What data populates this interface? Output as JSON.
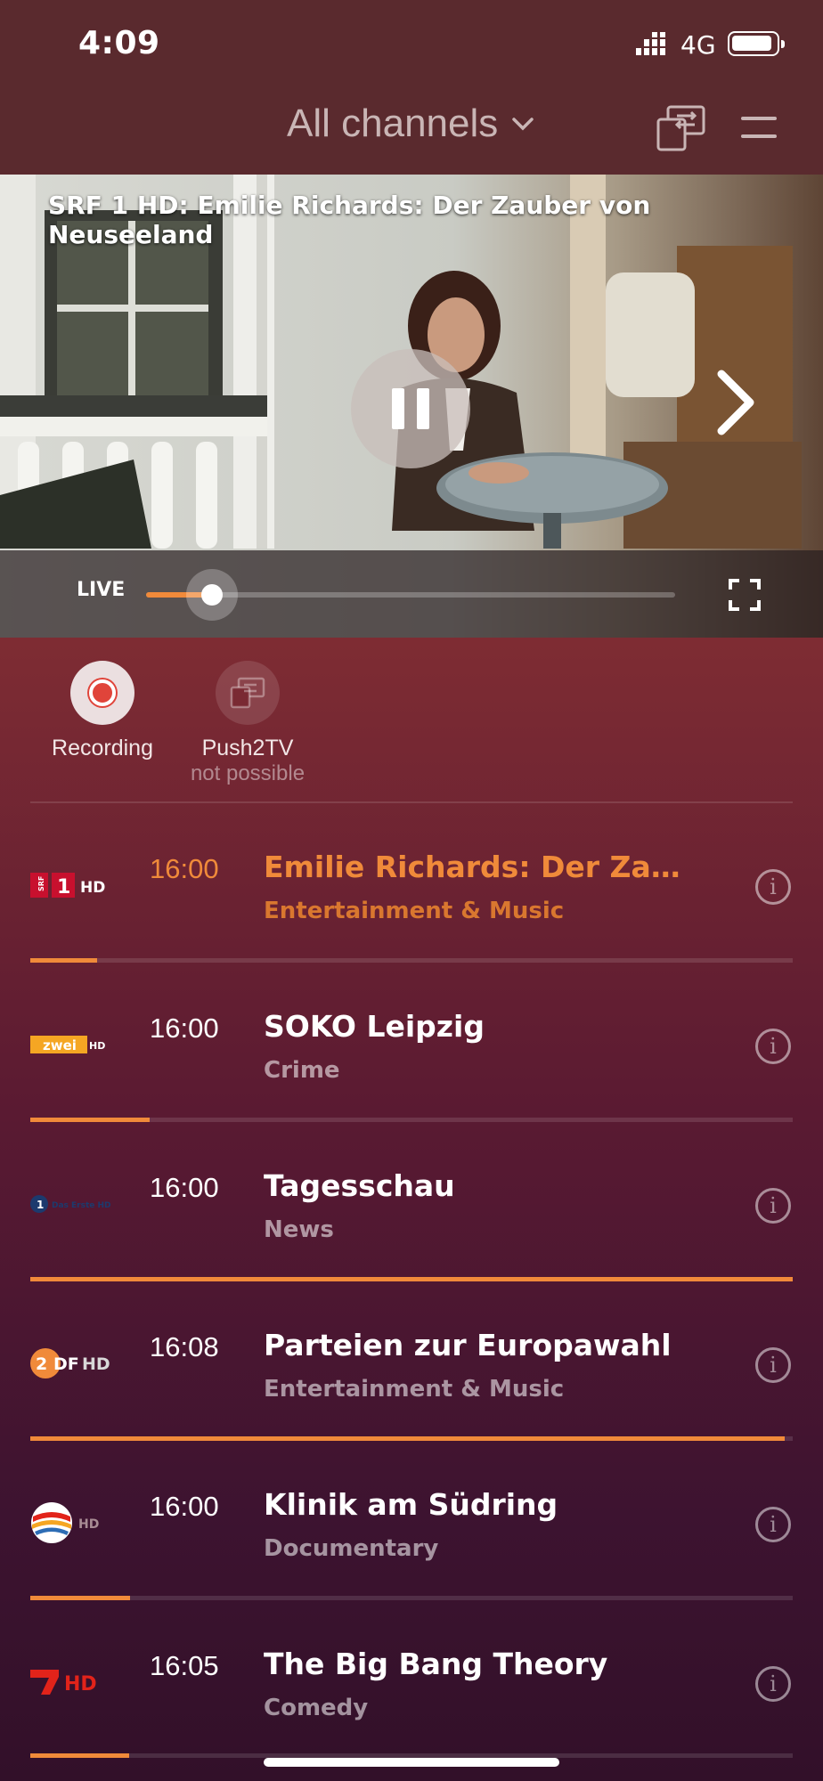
{
  "status_bar": {
    "time": "4:09",
    "network": "4G"
  },
  "header": {
    "channel_select_label": "All channels"
  },
  "player": {
    "title": "SRF 1 HD: Emilie Richards: Der Zauber von Neuseeland",
    "live_label": "LIVE",
    "progress": 0.125
  },
  "actions": {
    "recording_label": "Recording",
    "push_label": "Push2TV",
    "push_sublabel": "not possible"
  },
  "channels": [
    {
      "logo": "SRF 1 HD",
      "time": "16:00",
      "title": "Emilie Richards: Der Zaub...",
      "genre": "Entertainment & Music",
      "progress": 0.088,
      "active": true
    },
    {
      "logo": "ZDF zwei HD",
      "time": "16:00",
      "title": "SOKO Leipzig",
      "genre": "Crime",
      "progress": 0.157,
      "active": false
    },
    {
      "logo": "Das Erste HD",
      "time": "16:00",
      "title": "Tagesschau",
      "genre": "News",
      "progress": 1.0,
      "active": false
    },
    {
      "logo": "ZDF HD",
      "time": "16:08",
      "title": "Parteien zur Europawahl",
      "genre": "Entertainment & Music",
      "progress": 0.99,
      "active": false
    },
    {
      "logo": "Sat.1 HD",
      "time": "16:00",
      "title": "Klinik am Südring",
      "genre": "Documentary",
      "progress": 0.131,
      "active": false
    },
    {
      "logo": "ProSieben HD",
      "time": "16:05",
      "title": "The Big Bang Theory",
      "genre": "Comedy",
      "progress": 0.13,
      "active": false
    }
  ],
  "colors": {
    "accent": "#f08a3a",
    "background_top": "#5a2a2e",
    "background_bottom": "#321029"
  },
  "icons": [
    "signal-icon",
    "battery-icon",
    "chevron-down-icon",
    "push2tv-icon",
    "menu-icon",
    "pause-icon",
    "chevron-right-icon",
    "fullscreen-icon",
    "record-icon",
    "info-icon"
  ]
}
